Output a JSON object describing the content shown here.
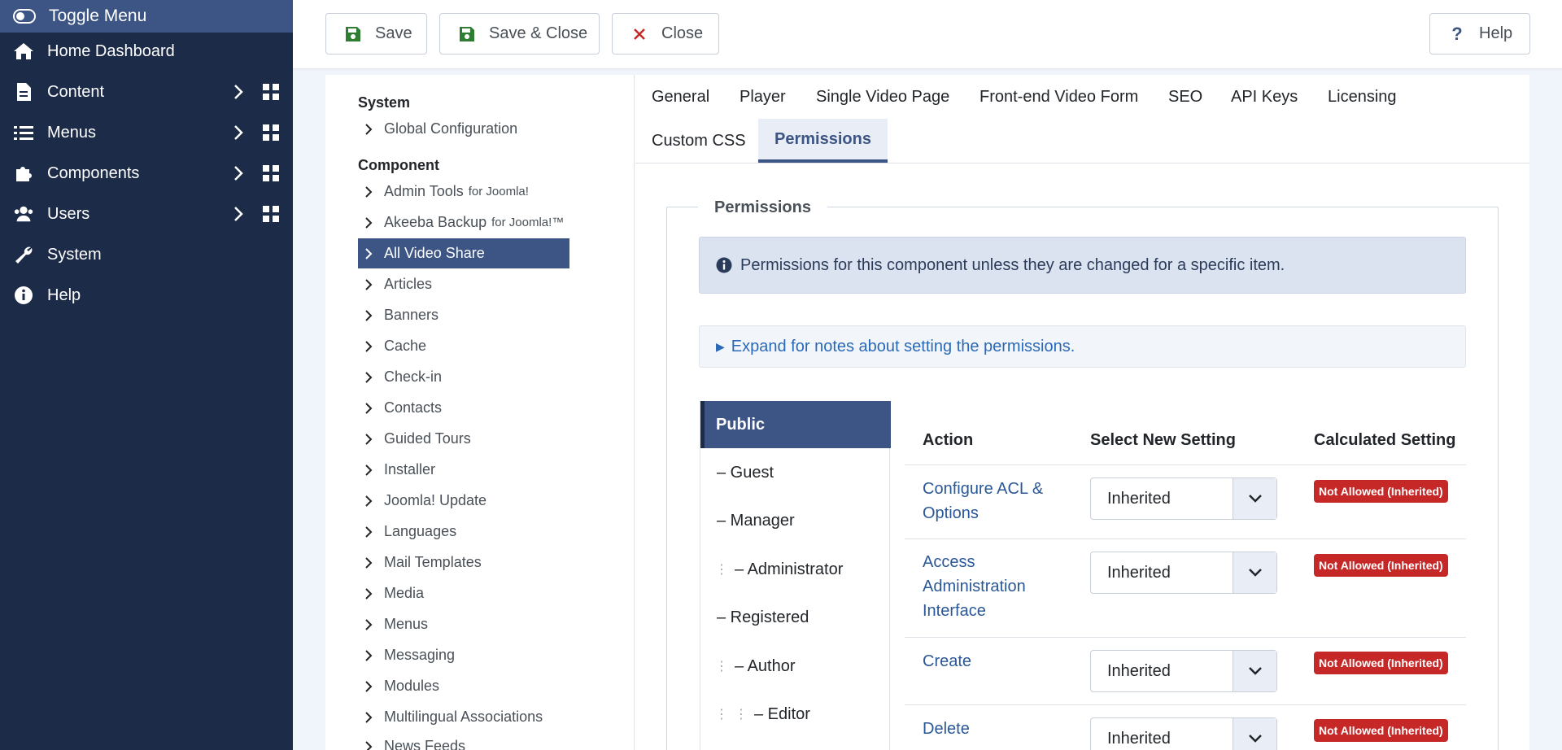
{
  "sidebar": {
    "toggle_label": "Toggle Menu",
    "items": [
      {
        "label": "Home Dashboard",
        "icon": "home-icon"
      },
      {
        "label": "Content",
        "icon": "file-icon"
      },
      {
        "label": "Menus",
        "icon": "list-icon"
      },
      {
        "label": "Components",
        "icon": "puzzle-icon"
      },
      {
        "label": "Users",
        "icon": "users-icon"
      },
      {
        "label": "System",
        "icon": "wrench-icon"
      },
      {
        "label": "Help",
        "icon": "info-icon"
      }
    ]
  },
  "toolbar": {
    "save_label": "Save",
    "save_close_label": "Save & Close",
    "close_label": "Close",
    "help_label": "Help"
  },
  "tree": {
    "system_heading": "System",
    "global_config": "Global Configuration",
    "component_heading": "Component",
    "items": [
      {
        "label": "Admin Tools",
        "suffix": "for Joomla!"
      },
      {
        "label": "Akeeba Backup",
        "suffix": "for Joomla!™"
      },
      {
        "label": "All Video Share",
        "suffix": ""
      },
      {
        "label": "Articles",
        "suffix": ""
      },
      {
        "label": "Banners",
        "suffix": ""
      },
      {
        "label": "Cache",
        "suffix": ""
      },
      {
        "label": "Check-in",
        "suffix": ""
      },
      {
        "label": "Contacts",
        "suffix": ""
      },
      {
        "label": "Guided Tours",
        "suffix": ""
      },
      {
        "label": "Installer",
        "suffix": ""
      },
      {
        "label": "Joomla! Update",
        "suffix": ""
      },
      {
        "label": "Languages",
        "suffix": ""
      },
      {
        "label": "Mail Templates",
        "suffix": ""
      },
      {
        "label": "Media",
        "suffix": ""
      },
      {
        "label": "Menus",
        "suffix": ""
      },
      {
        "label": "Messaging",
        "suffix": ""
      },
      {
        "label": "Modules",
        "suffix": ""
      },
      {
        "label": "Multilingual Associations",
        "suffix": ""
      },
      {
        "label": "News Feeds",
        "suffix": ""
      }
    ]
  },
  "tabs": [
    {
      "label": "General"
    },
    {
      "label": "Player"
    },
    {
      "label": "Single Video Page"
    },
    {
      "label": "Front-end Video Form"
    },
    {
      "label": "SEO"
    },
    {
      "label": "API Keys"
    },
    {
      "label": "Licensing"
    },
    {
      "label": "Custom CSS"
    },
    {
      "label": "Permissions"
    }
  ],
  "permissions": {
    "legend": "Permissions",
    "info_text": "Permissions for this component unless they are changed for a specific item.",
    "details_text": "Expand for notes about setting the permissions.",
    "groups": [
      {
        "label": "Public"
      },
      {
        "label": "– Guest"
      },
      {
        "label": "– Manager"
      },
      {
        "label": "– Administrator"
      },
      {
        "label": "– Registered"
      },
      {
        "label": "– Author"
      },
      {
        "label": "– Editor"
      }
    ],
    "columns": {
      "action": "Action",
      "select": "Select New Setting",
      "calculated": "Calculated Setting"
    },
    "rows": [
      {
        "action": "Configure ACL & Options",
        "setting": "Inherited",
        "calculated": "Not Allowed (Inherited)"
      },
      {
        "action": "Access Administration Interface",
        "setting": "Inherited",
        "calculated": "Not Allowed (Inherited)"
      },
      {
        "action": "Create",
        "setting": "Inherited",
        "calculated": "Not Allowed (Inherited)"
      },
      {
        "action": "Delete",
        "setting": "Inherited",
        "calculated": "Not Allowed (Inherited)"
      }
    ]
  },
  "colors": {
    "sidebar_bg": "#1c2b48",
    "accent": "#3c5584",
    "danger": "#c52827",
    "save_icon": "#2f7d32",
    "close_icon": "#c52827"
  }
}
